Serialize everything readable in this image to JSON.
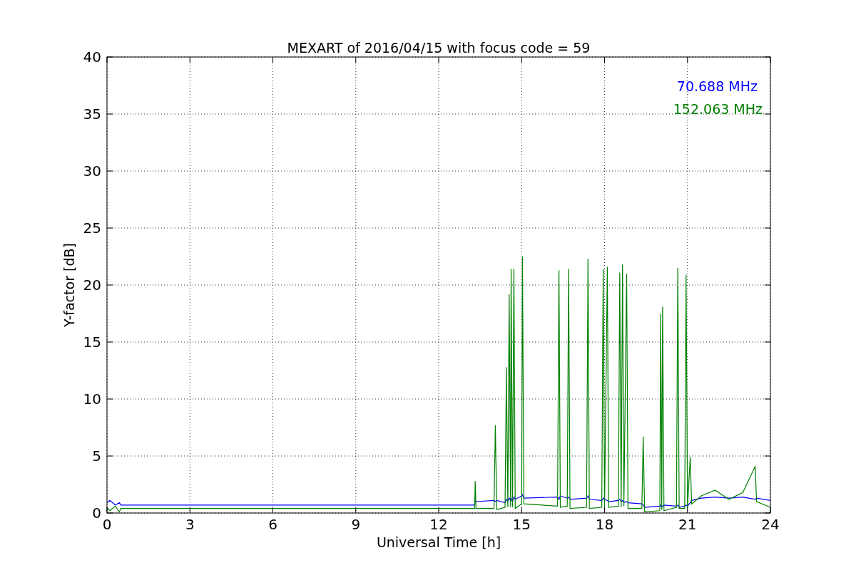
{
  "figure": {
    "chart_data": {
      "type": "line",
      "grid": true,
      "title": "MEXART of 2016/04/15 with focus code = 59",
      "xlabel": "Universal Time [h]",
      "ylabel": "Y-factor [dB]",
      "xlim": [
        0,
        24
      ],
      "ylim": [
        0,
        40
      ],
      "xticks": [
        0,
        3,
        6,
        9,
        12,
        15,
        18,
        21,
        24
      ],
      "yticks": [
        0,
        5,
        10,
        15,
        20,
        25,
        30,
        35,
        40
      ],
      "x": [
        0,
        0.1,
        0.3,
        0.45,
        0.5,
        13.3,
        13.32,
        13.35,
        14.0,
        14.05,
        14.1,
        14.4,
        14.45,
        14.5,
        14.55,
        14.6,
        14.62,
        14.67,
        14.72,
        14.77,
        15.0,
        15.03,
        15.08,
        16.3,
        16.35,
        16.4,
        16.65,
        16.7,
        16.75,
        17.35,
        17.4,
        17.45,
        17.9,
        17.95,
        18.0,
        18.1,
        18.15,
        18.5,
        18.55,
        18.6,
        18.65,
        18.7,
        18.8,
        18.85,
        19.35,
        19.4,
        19.45,
        20.0,
        20.03,
        20.07,
        20.1,
        20.15,
        20.6,
        20.65,
        20.7,
        20.9,
        20.95,
        21.0,
        21.1,
        21.15,
        21.5,
        22.0,
        22.5,
        23.0,
        23.45,
        23.5,
        24.0
      ],
      "series": [
        {
          "name": "70.688 MHz",
          "color": "#0000ff",
          "values": [
            0.9,
            1.1,
            0.7,
            0.9,
            0.7,
            0.7,
            1.1,
            1.0,
            1.1,
            1.0,
            1.1,
            0.9,
            1.2,
            1.0,
            1.3,
            1.1,
            1.3,
            1.0,
            1.4,
            1.2,
            1.5,
            1.6,
            1.3,
            1.4,
            1.2,
            1.5,
            1.3,
            1.4,
            1.2,
            1.3,
            1.5,
            1.2,
            1.1,
            1.3,
            1.2,
            1.1,
            1.0,
            1.1,
            1.2,
            1.0,
            1.1,
            0.9,
            1.0,
            0.9,
            0.8,
            0.7,
            0.5,
            0.6,
            0.7,
            0.5,
            0.6,
            0.7,
            0.6,
            0.7,
            0.5,
            0.6,
            0.7,
            0.6,
            0.9,
            1.1,
            1.3,
            1.4,
            1.3,
            1.4,
            1.2,
            1.3,
            1.1
          ]
        },
        {
          "name": "152.063 MHz",
          "color": "#008000",
          "values": [
            0.5,
            0.2,
            0.6,
            0.1,
            0.4,
            0.4,
            2.8,
            0.4,
            0.4,
            7.7,
            0.3,
            0.5,
            12.8,
            0.5,
            19.2,
            0.5,
            21.4,
            0.5,
            21.4,
            0.4,
            0.8,
            22.5,
            0.8,
            0.6,
            21.3,
            0.5,
            0.6,
            21.4,
            0.4,
            0.5,
            22.3,
            0.4,
            0.5,
            21.4,
            0.5,
            21.6,
            0.5,
            0.6,
            21.1,
            0.5,
            21.8,
            0.6,
            21.0,
            0.4,
            0.4,
            6.7,
            0.1,
            0.2,
            17.5,
            0.3,
            18.1,
            0.2,
            0.5,
            21.5,
            0.4,
            0.4,
            20.9,
            0.5,
            4.9,
            0.8,
            1.5,
            2.0,
            1.2,
            1.8,
            4.1,
            1.0,
            0.5
          ]
        }
      ]
    }
  }
}
